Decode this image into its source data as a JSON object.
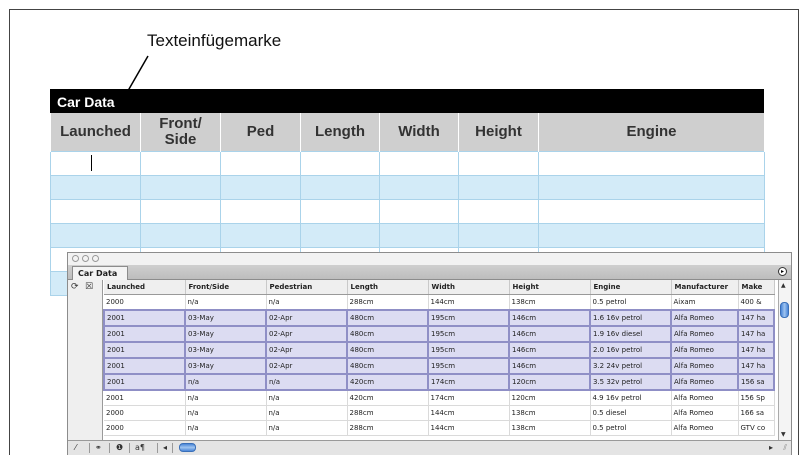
{
  "callout": {
    "label": "Texteinfügemarke"
  },
  "document_table": {
    "title": "Car Data",
    "headers": [
      "Launched",
      "Front/\nSide",
      "Ped",
      "Length",
      "Width",
      "Height",
      "Engine"
    ],
    "row_stripes": [
      "white",
      "blue",
      "white",
      "blue",
      "white",
      "blue"
    ]
  },
  "palette": {
    "tab": "Car Data",
    "columns": [
      "Launched",
      "Front/Side",
      "Pedestrian",
      "Length",
      "Width",
      "Height",
      "Engine",
      "Manufacturer",
      "Make"
    ],
    "rows": [
      {
        "selected": false,
        "cells": [
          "2000",
          "n/a",
          "n/a",
          "288cm",
          "144cm",
          "138cm",
          "0.5 petrol",
          "Aixam",
          "400 &"
        ]
      },
      {
        "selected": true,
        "cells": [
          "2001",
          "03-May",
          "02-Apr",
          "480cm",
          "195cm",
          "146cm",
          "1.6 16v petrol",
          "Alfa Romeo",
          "147 ha"
        ]
      },
      {
        "selected": true,
        "cells": [
          "2001",
          "03-May",
          "02-Apr",
          "480cm",
          "195cm",
          "146cm",
          "1.9 16v diesel",
          "Alfa Romeo",
          "147 ha"
        ]
      },
      {
        "selected": true,
        "cells": [
          "2001",
          "03-May",
          "02-Apr",
          "480cm",
          "195cm",
          "146cm",
          "2.0 16v petrol",
          "Alfa Romeo",
          "147 ha"
        ]
      },
      {
        "selected": true,
        "cells": [
          "2001",
          "03-May",
          "02-Apr",
          "480cm",
          "195cm",
          "146cm",
          "3.2 24v petrol",
          "Alfa Romeo",
          "147 ha"
        ]
      },
      {
        "selected": true,
        "cells": [
          "2001",
          "n/a",
          "n/a",
          "420cm",
          "174cm",
          "120cm",
          "3.5 32v petrol",
          "Alfa Romeo",
          "156 sa"
        ]
      },
      {
        "selected": false,
        "cells": [
          "2001",
          "n/a",
          "n/a",
          "420cm",
          "174cm",
          "120cm",
          "4.9 16v petrol",
          "Alfa Romeo",
          "156 Sp"
        ]
      },
      {
        "selected": false,
        "cells": [
          "2000",
          "n/a",
          "n/a",
          "288cm",
          "144cm",
          "138cm",
          "0.5 diesel",
          "Alfa Romeo",
          "166 sa"
        ]
      },
      {
        "selected": false,
        "cells": [
          "2000",
          "n/a",
          "n/a",
          "288cm",
          "144cm",
          "138cm",
          "0.5 petrol",
          "Alfa Romeo",
          "GTV co"
        ]
      }
    ],
    "icons": [
      "refresh-icon",
      "checkbox-icon",
      "pen-icon",
      "binoculars-icon",
      "info-icon",
      "text-options-icon"
    ],
    "bottom_symbols": {
      "binoculars": "⚭",
      "info": "❶",
      "text": "a¶",
      "left": "◂",
      "right": "▸"
    }
  }
}
